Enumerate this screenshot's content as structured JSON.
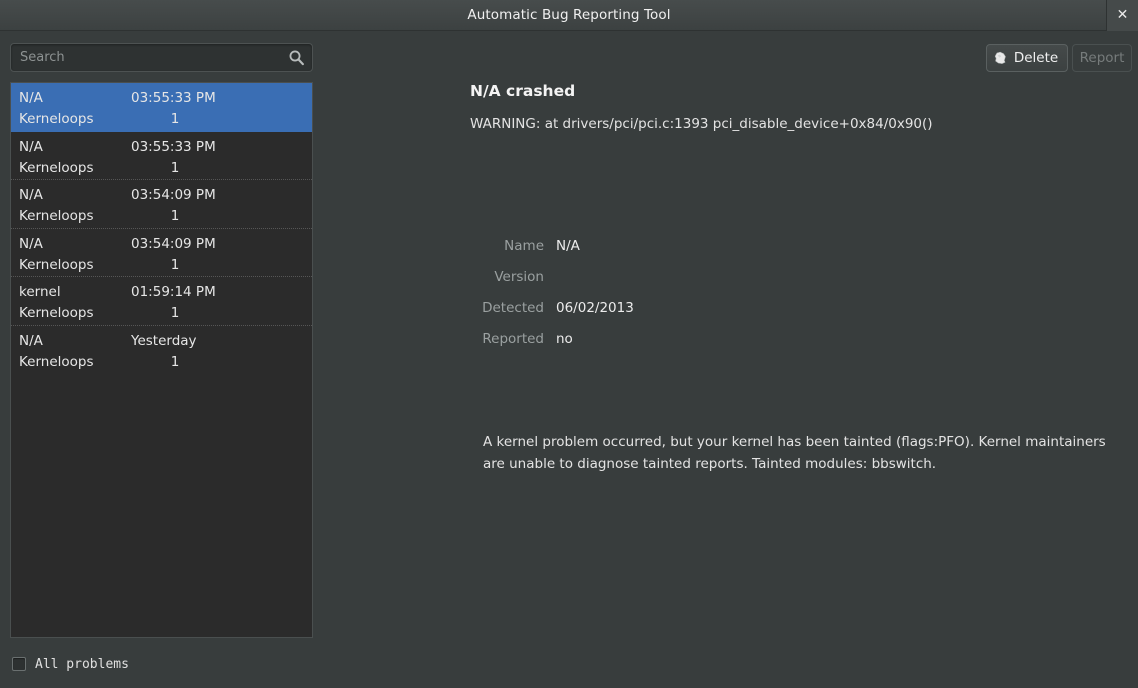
{
  "window": {
    "title": "Automatic Bug Reporting Tool",
    "close_label": "✕"
  },
  "search": {
    "placeholder": "Search",
    "value": "",
    "icon": "search-icon"
  },
  "toolbar": {
    "delete_label": "Delete",
    "delete_icon": "trash-icon",
    "report_label": "Report",
    "report_enabled": false
  },
  "problem_list": {
    "rows": [
      {
        "name": "N/A",
        "time": "03:55:33 PM",
        "source": "Kerneloops",
        "count": "1",
        "selected": true
      },
      {
        "name": "N/A",
        "time": "03:55:33 PM",
        "source": "Kerneloops",
        "count": "1",
        "selected": false
      },
      {
        "name": "N/A",
        "time": "03:54:09 PM",
        "source": "Kerneloops",
        "count": "1",
        "selected": false
      },
      {
        "name": "N/A",
        "time": "03:54:09 PM",
        "source": "Kerneloops",
        "count": "1",
        "selected": false
      },
      {
        "name": "kernel",
        "time": "01:59:14 PM",
        "source": "Kerneloops",
        "count": "1",
        "selected": false
      },
      {
        "name": "N/A",
        "time": "Yesterday",
        "source": "Kerneloops",
        "count": "1",
        "selected": false
      }
    ]
  },
  "footer": {
    "all_problems_label": "All problems",
    "all_problems_checked": false
  },
  "detail": {
    "title": "N/A crashed",
    "reason": "WARNING: at drivers/pci/pci.c:1393 pci_disable_device+0x84/0x90()",
    "fields": [
      {
        "label": "Name",
        "value": "N/A"
      },
      {
        "label": "Version",
        "value": ""
      },
      {
        "label": "Detected",
        "value": "06/02/2013"
      },
      {
        "label": "Reported",
        "value": "no"
      }
    ],
    "description": "A kernel problem occurred, but your kernel has been tainted (flags:PFO). Kernel maintainers are unable to diagnose tainted reports. Tainted modules: bbswitch."
  },
  "colors": {
    "window_bg": "#383d3d",
    "titlebar_bg": "#454a4a",
    "list_bg": "#2b2b2b",
    "selection": "#3a6eb4",
    "text": "#e8e8e8",
    "label_text": "#9aa0a0",
    "disabled_text": "#767b7b"
  }
}
